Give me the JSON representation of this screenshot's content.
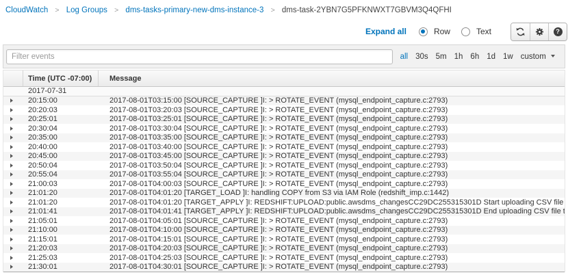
{
  "breadcrumb": {
    "separator": ">",
    "items": [
      {
        "label": "CloudWatch",
        "type": "link"
      },
      {
        "label": "Log Groups",
        "type": "link"
      },
      {
        "label": "dms-tasks-primary-new-dms-instance-3",
        "type": "link"
      },
      {
        "label": "dms-task-2YBN7G5PFKNWXT7GBVM3Q4QFHI",
        "type": "current"
      }
    ]
  },
  "toolbar": {
    "expand_all_label": "Expand all",
    "view_modes": [
      {
        "label": "Row",
        "selected": true
      },
      {
        "label": "Text",
        "selected": false
      }
    ],
    "help_glyph": "?",
    "icons": {
      "refresh": "circular-arrows",
      "settings": "gear",
      "help": "question-mark-circle"
    }
  },
  "filter": {
    "placeholder": "Filter events",
    "ranges": [
      {
        "label": "all",
        "active": true
      },
      {
        "label": "30s",
        "active": false
      },
      {
        "label": "5m",
        "active": false
      },
      {
        "label": "1h",
        "active": false
      },
      {
        "label": "6h",
        "active": false
      },
      {
        "label": "1d",
        "active": false
      },
      {
        "label": "1w",
        "active": false
      },
      {
        "label": "custom",
        "active": false,
        "dropdown": true
      }
    ]
  },
  "table": {
    "columns": {
      "time": "Time (UTC -07:00)",
      "message": "Message"
    },
    "date_separator": "2017-07-31",
    "rows": [
      {
        "time": "20:15:00",
        "message": "2017-08-01T03:15:00 [SOURCE_CAPTURE ]I: > ROTATE_EVENT (mysql_endpoint_capture.c:2793)"
      },
      {
        "time": "20:20:03",
        "message": "2017-08-01T03:20:03 [SOURCE_CAPTURE ]I: > ROTATE_EVENT (mysql_endpoint_capture.c:2793)"
      },
      {
        "time": "20:25:01",
        "message": "2017-08-01T03:25:01 [SOURCE_CAPTURE ]I: > ROTATE_EVENT (mysql_endpoint_capture.c:2793)"
      },
      {
        "time": "20:30:04",
        "message": "2017-08-01T03:30:04 [SOURCE_CAPTURE ]I: > ROTATE_EVENT (mysql_endpoint_capture.c:2793)"
      },
      {
        "time": "20:35:00",
        "message": "2017-08-01T03:35:00 [SOURCE_CAPTURE ]I: > ROTATE_EVENT (mysql_endpoint_capture.c:2793)"
      },
      {
        "time": "20:40:00",
        "message": "2017-08-01T03:40:00 [SOURCE_CAPTURE ]I: > ROTATE_EVENT (mysql_endpoint_capture.c:2793)"
      },
      {
        "time": "20:45:00",
        "message": "2017-08-01T03:45:00 [SOURCE_CAPTURE ]I: > ROTATE_EVENT (mysql_endpoint_capture.c:2793)"
      },
      {
        "time": "20:50:04",
        "message": "2017-08-01T03:50:04 [SOURCE_CAPTURE ]I: > ROTATE_EVENT (mysql_endpoint_capture.c:2793)"
      },
      {
        "time": "20:55:04",
        "message": "2017-08-01T03:55:04 [SOURCE_CAPTURE ]I: > ROTATE_EVENT (mysql_endpoint_capture.c:2793)"
      },
      {
        "time": "21:00:03",
        "message": "2017-08-01T04:00:03 [SOURCE_CAPTURE ]I: > ROTATE_EVENT (mysql_endpoint_capture.c:2793)"
      },
      {
        "time": "21:01:20",
        "message": "2017-08-01T04:01:20 [TARGET_LOAD ]I: handling COPY from S3 via IAM Role (redshift_imp.c:1442)"
      },
      {
        "time": "21:01:20",
        "message": "2017-08-01T04:01:20 [TARGET_APPLY ]I: REDSHIFT:UPLOAD:public.awsdms_changesCC29DC255315301D Start uploading CSV file to database (redshift_i"
      },
      {
        "time": "21:01:41",
        "message": "2017-08-01T04:01:41 [TARGET_APPLY ]I: REDSHIFT:UPLOAD:public.awsdms_changesCC29DC255315301D End uploading CSV file to database (redshift_in"
      },
      {
        "time": "21:05:01",
        "message": "2017-08-01T04:05:01 [SOURCE_CAPTURE ]I: > ROTATE_EVENT (mysql_endpoint_capture.c:2793)"
      },
      {
        "time": "21:10:00",
        "message": "2017-08-01T04:10:00 [SOURCE_CAPTURE ]I: > ROTATE_EVENT (mysql_endpoint_capture.c:2793)"
      },
      {
        "time": "21:15:01",
        "message": "2017-08-01T04:15:01 [SOURCE_CAPTURE ]I: > ROTATE_EVENT (mysql_endpoint_capture.c:2793)"
      },
      {
        "time": "21:20:03",
        "message": "2017-08-01T04:20:03 [SOURCE_CAPTURE ]I: > ROTATE_EVENT (mysql_endpoint_capture.c:2793)"
      },
      {
        "time": "21:25:03",
        "message": "2017-08-01T04:25:03 [SOURCE_CAPTURE ]I: > ROTATE_EVENT (mysql_endpoint_capture.c:2793)"
      },
      {
        "time": "21:30:01",
        "message": "2017-08-01T04:30:01 [SOURCE_CAPTURE ]I: > ROTATE_EVENT (mysql_endpoint_capture.c:2793)"
      }
    ]
  },
  "colors": {
    "link_blue": "#0073bb",
    "text_dark": "#333333",
    "row_alt": "#f5f5f5"
  }
}
